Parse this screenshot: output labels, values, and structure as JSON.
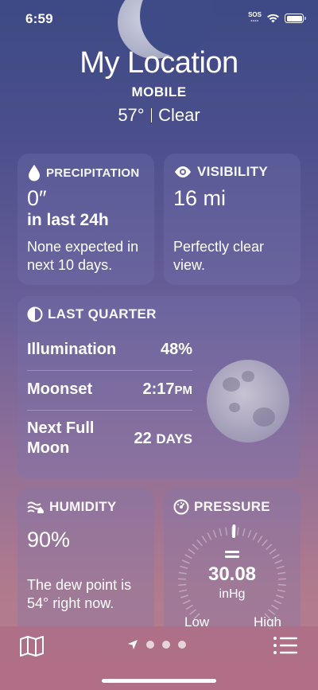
{
  "status": {
    "time": "6:59",
    "carrier": "SOS"
  },
  "header": {
    "location": "My Location",
    "subtitle": "MOBILE",
    "temp": "57°",
    "condition": "Clear"
  },
  "precipitation": {
    "title": "PRECIPITATION",
    "icon": "raindrop-icon",
    "value": "0″",
    "period": "in last 24h",
    "description": "None expected in next 10 days."
  },
  "visibility": {
    "title": "VISIBILITY",
    "icon": "eye-icon",
    "value": "16 mi",
    "description": "Perfectly clear view."
  },
  "moon": {
    "title": "LAST QUARTER",
    "icon": "moon-phase-icon",
    "rows": [
      {
        "label": "Illumination",
        "value": "48%",
        "unit": ""
      },
      {
        "label": "Moonset",
        "value": "2:17",
        "unit": "PM"
      },
      {
        "label": "Next Full Moon",
        "value": "22",
        "unit": "DAYS"
      }
    ]
  },
  "humidity": {
    "title": "HUMIDITY",
    "icon": "humidity-icon",
    "value": "90%",
    "description": "The dew point is 54° right now."
  },
  "pressure": {
    "title": "PRESSURE",
    "icon": "gauge-icon",
    "value": "30.08",
    "unit": "inHg",
    "low_label": "Low",
    "high_label": "High"
  },
  "toolbar": {
    "map_icon": "map-icon",
    "location_icon": "location-arrow-icon",
    "list_icon": "list-icon"
  }
}
